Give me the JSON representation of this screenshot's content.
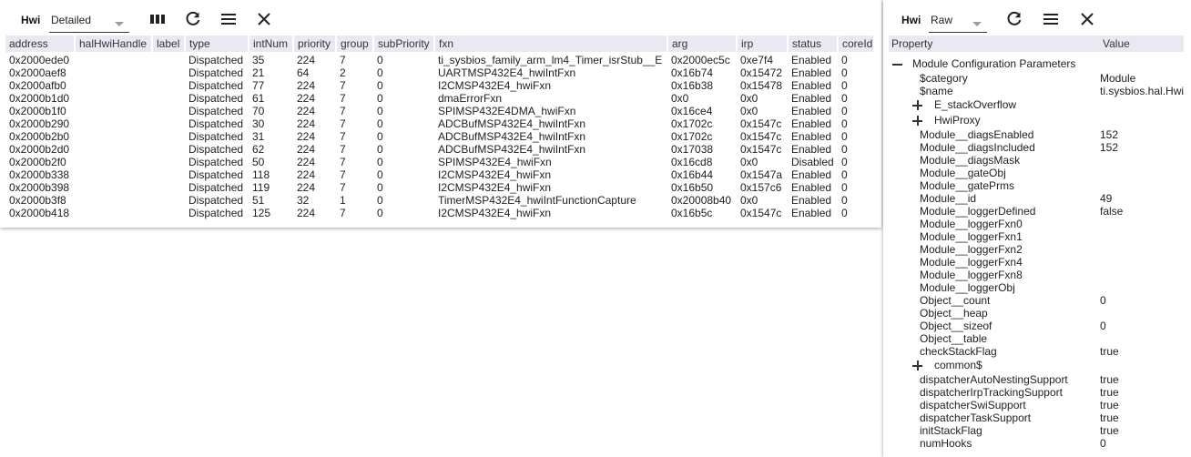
{
  "left": {
    "title": "Hwi",
    "view_select": "Detailed",
    "columns": [
      "address",
      "halHwiHandle",
      "label",
      "type",
      "intNum",
      "priority",
      "group",
      "subPriority",
      "fxn",
      "arg",
      "irp",
      "status",
      "coreId"
    ],
    "rows": [
      [
        "0x2000ede0",
        "",
        "",
        "Dispatched",
        "35",
        "224",
        "7",
        "0",
        "ti_sysbios_family_arm_lm4_Timer_isrStub__E",
        "0x2000ec5c",
        "0xe7f4",
        "Enabled",
        "0"
      ],
      [
        "0x2000aef8",
        "",
        "",
        "Dispatched",
        "21",
        "64",
        "2",
        "0",
        "UARTMSP432E4_hwiIntFxn",
        "0x16b74",
        "0x15472",
        "Enabled",
        "0"
      ],
      [
        "0x2000afb0",
        "",
        "",
        "Dispatched",
        "77",
        "224",
        "7",
        "0",
        "I2CMSP432E4_hwiFxn",
        "0x16b38",
        "0x15478",
        "Enabled",
        "0"
      ],
      [
        "0x2000b1d0",
        "",
        "",
        "Dispatched",
        "61",
        "224",
        "7",
        "0",
        "dmaErrorFxn",
        "0x0",
        "0x0",
        "Enabled",
        "0"
      ],
      [
        "0x2000b1f0",
        "",
        "",
        "Dispatched",
        "70",
        "224",
        "7",
        "0",
        "SPIMSP432E4DMA_hwiFxn",
        "0x16ce4",
        "0x0",
        "Enabled",
        "0"
      ],
      [
        "0x2000b290",
        "",
        "",
        "Dispatched",
        "30",
        "224",
        "7",
        "0",
        "ADCBufMSP432E4_hwiIntFxn",
        "0x1702c",
        "0x1547c",
        "Enabled",
        "0"
      ],
      [
        "0x2000b2b0",
        "",
        "",
        "Dispatched",
        "31",
        "224",
        "7",
        "0",
        "ADCBufMSP432E4_hwiIntFxn",
        "0x1702c",
        "0x1547c",
        "Enabled",
        "0"
      ],
      [
        "0x2000b2d0",
        "",
        "",
        "Dispatched",
        "62",
        "224",
        "7",
        "0",
        "ADCBufMSP432E4_hwiIntFxn",
        "0x17038",
        "0x1547c",
        "Enabled",
        "0"
      ],
      [
        "0x2000b2f0",
        "",
        "",
        "Dispatched",
        "50",
        "224",
        "7",
        "0",
        "SPIMSP432E4_hwiFxn",
        "0x16cd8",
        "0x0",
        "Disabled",
        "0"
      ],
      [
        "0x2000b338",
        "",
        "",
        "Dispatched",
        "118",
        "224",
        "7",
        "0",
        "I2CMSP432E4_hwiFxn",
        "0x16b44",
        "0x1547a",
        "Enabled",
        "0"
      ],
      [
        "0x2000b398",
        "",
        "",
        "Dispatched",
        "119",
        "224",
        "7",
        "0",
        "I2CMSP432E4_hwiFxn",
        "0x16b50",
        "0x157c6",
        "Enabled",
        "0"
      ],
      [
        "0x2000b3f8",
        "",
        "",
        "Dispatched",
        "51",
        "32",
        "1",
        "0",
        "TimerMSP432E4_hwiIntFunctionCapture",
        "0x20008b40",
        "0x0",
        "Enabled",
        "0"
      ],
      [
        "0x2000b418",
        "",
        "",
        "Dispatched",
        "125",
        "224",
        "7",
        "0",
        "I2CMSP432E4_hwiFxn",
        "0x16b5c",
        "0x1547c",
        "Enabled",
        "0"
      ]
    ]
  },
  "right": {
    "title": "Hwi",
    "view_select": "Raw",
    "columns": [
      "Property",
      "Value"
    ],
    "section_label": "Module Configuration Parameters",
    "items": [
      {
        "k": "$category",
        "v": "Module",
        "t": "leaf"
      },
      {
        "k": "$name",
        "v": "ti.sysbios.hal.Hwi",
        "t": "leaf"
      },
      {
        "k": "E_stackOverflow",
        "v": "",
        "t": "collapsed"
      },
      {
        "k": "HwiProxy",
        "v": "",
        "t": "collapsed"
      },
      {
        "k": "Module__diagsEnabled",
        "v": "152",
        "t": "leaf"
      },
      {
        "k": "Module__diagsIncluded",
        "v": "152",
        "t": "leaf"
      },
      {
        "k": "Module__diagsMask",
        "v": "",
        "t": "leaf"
      },
      {
        "k": "Module__gateObj",
        "v": "",
        "t": "leaf"
      },
      {
        "k": "Module__gatePrms",
        "v": "",
        "t": "leaf"
      },
      {
        "k": "Module__id",
        "v": "49",
        "t": "leaf"
      },
      {
        "k": "Module__loggerDefined",
        "v": "false",
        "t": "leaf"
      },
      {
        "k": "Module__loggerFxn0",
        "v": "",
        "t": "leaf"
      },
      {
        "k": "Module__loggerFxn1",
        "v": "",
        "t": "leaf"
      },
      {
        "k": "Module__loggerFxn2",
        "v": "",
        "t": "leaf"
      },
      {
        "k": "Module__loggerFxn4",
        "v": "",
        "t": "leaf"
      },
      {
        "k": "Module__loggerFxn8",
        "v": "",
        "t": "leaf"
      },
      {
        "k": "Module__loggerObj",
        "v": "",
        "t": "leaf"
      },
      {
        "k": "Object__count",
        "v": "0",
        "t": "leaf"
      },
      {
        "k": "Object__heap",
        "v": "",
        "t": "leaf"
      },
      {
        "k": "Object__sizeof",
        "v": "0",
        "t": "leaf"
      },
      {
        "k": "Object__table",
        "v": "",
        "t": "leaf"
      },
      {
        "k": "checkStackFlag",
        "v": "true",
        "t": "leaf"
      },
      {
        "k": "common$",
        "v": "",
        "t": "collapsed"
      },
      {
        "k": "dispatcherAutoNestingSupport",
        "v": "true",
        "t": "leaf"
      },
      {
        "k": "dispatcherIrpTrackingSupport",
        "v": "true",
        "t": "leaf"
      },
      {
        "k": "dispatcherSwiSupport",
        "v": "true",
        "t": "leaf"
      },
      {
        "k": "dispatcherTaskSupport",
        "v": "true",
        "t": "leaf"
      },
      {
        "k": "initStackFlag",
        "v": "true",
        "t": "leaf"
      },
      {
        "k": "numHooks",
        "v": "0",
        "t": "leaf"
      }
    ]
  },
  "icons": {
    "columns": "columns-icon",
    "refresh": "refresh-icon",
    "menu": "menu-icon",
    "close": "close-icon"
  }
}
